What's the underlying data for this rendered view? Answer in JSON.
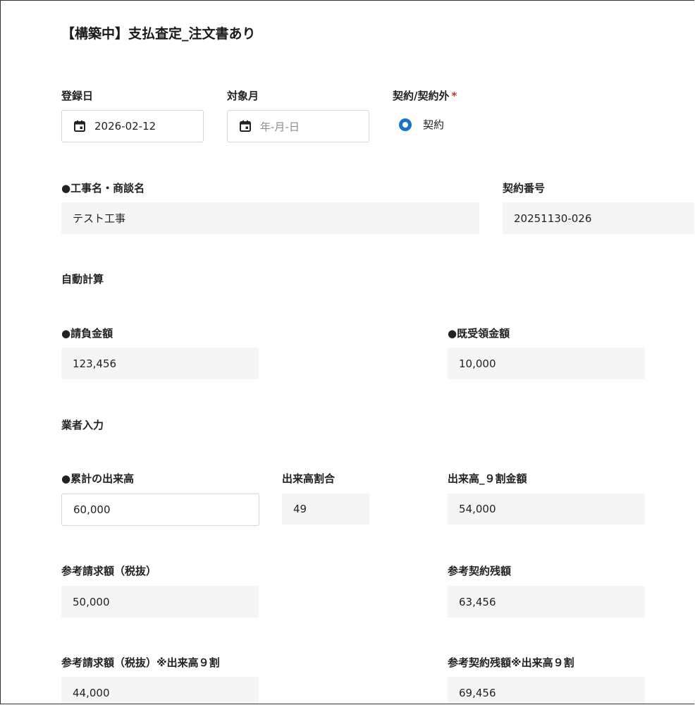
{
  "title": "【構築中】支払査定_注文書あり",
  "registration_date": {
    "label": "登録日",
    "value": "2026-02-12",
    "icon": "calendar-icon"
  },
  "target_month": {
    "label": "対象月",
    "placeholder": "年-月-日",
    "icon": "calendar-icon"
  },
  "contract_type": {
    "label": "契約/契約外",
    "required_mark": "*",
    "selected_option": "契約"
  },
  "project_name": {
    "label": "●工事名・商談名",
    "value": "テスト工事"
  },
  "contract_number": {
    "label": "契約番号",
    "value": "20251130-026"
  },
  "sections": {
    "auto_calc": "自動計算",
    "vendor_input": "業者入力"
  },
  "contract_amount": {
    "label": "●請負金額",
    "value": "123,456"
  },
  "received_amount": {
    "label": "●既受領金額",
    "value": "10,000"
  },
  "cumulative_progress": {
    "label": "●累計の出来高",
    "value": "60,000"
  },
  "progress_ratio": {
    "label": "出来高割合",
    "value": "49"
  },
  "progress_90": {
    "label": "出来高_９割金額",
    "value": "54,000"
  },
  "ref_billing": {
    "label": "参考請求額（税抜）",
    "value": "50,000"
  },
  "ref_contract_balance": {
    "label": "参考契約残額",
    "value": "63,456"
  },
  "ref_billing_90": {
    "label": "参考請求額（税抜）※出来高９割",
    "value": "44,000"
  },
  "ref_contract_balance_90": {
    "label": "参考契約残額※出来高９割",
    "value": "69,456"
  },
  "colors": {
    "accent": "#1a73c8",
    "required": "#c0392b",
    "readonly_bg": "#f5f5f5"
  }
}
